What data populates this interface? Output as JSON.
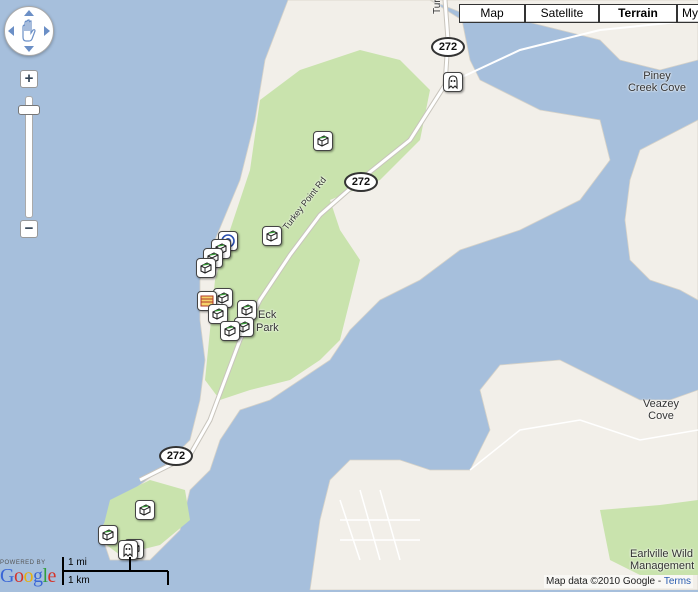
{
  "map_types": {
    "map": "Map",
    "satellite": "Satellite",
    "terrain": "Terrain",
    "mytopo": "MyT",
    "active": "Terrain"
  },
  "labels": {
    "piney_creek_cove": "Piney\nCreek Cove",
    "veazey_cove": "Veazey\nCove",
    "earlville": "Earlville Wild\nManagement",
    "turkey_point_rd": "Turkey Point Rd",
    "elk_neck_park_a": "Eck",
    "elk_neck_park_b": "Park",
    "road_fragment": "Tur"
  },
  "routes": {
    "r1": "272",
    "r2": "272",
    "r3": "272"
  },
  "scale": {
    "miles": "1 mi",
    "km": "1 km"
  },
  "copyright": {
    "text": "Map data ©2010 Google - ",
    "link": "Terms"
  },
  "logo": {
    "powered": "POWERED BY",
    "word": "Google"
  },
  "colors": {
    "water": "#a6bfdc",
    "land": "#f2efe9",
    "park": "#c9e3ad",
    "road": "#ffffff",
    "road_outline": "#c8c4bc"
  },
  "markers": {
    "icon_types": [
      "cache-icon",
      "ghost-icon",
      "multi-cache-icon"
    ]
  }
}
